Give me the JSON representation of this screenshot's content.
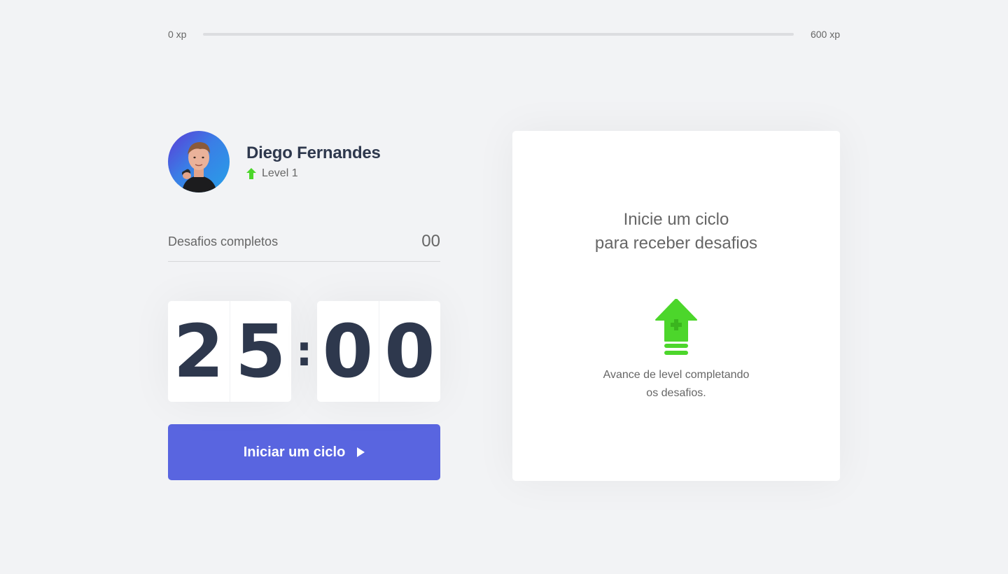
{
  "experience": {
    "min_label": "0 xp",
    "max_label": "600 xp",
    "progress": 0
  },
  "profile": {
    "name": "Diego Fernandes",
    "level_label": "Level 1",
    "avatar_icon": "user-photo",
    "level_icon": "level-up-arrow-icon"
  },
  "completed": {
    "label": "Desafios completos",
    "count": "00"
  },
  "countdown": {
    "minute_left": "2",
    "minute_right": "5",
    "separator": ":",
    "second_left": "0",
    "second_right": "0"
  },
  "start_button": {
    "label": "Iniciar um ciclo",
    "icon": "play-icon"
  },
  "challenge_box": {
    "title_line1": "Inicie um ciclo",
    "title_line2": "para receber desafios",
    "icon": "level-up-icon",
    "text_line1": "Avance de level completando",
    "text_line2": "os desafios."
  },
  "colors": {
    "background": "#f2f3f5",
    "accent": "#5965e0",
    "green": "#4cd62b",
    "title": "#2e384d",
    "text": "#666666"
  }
}
